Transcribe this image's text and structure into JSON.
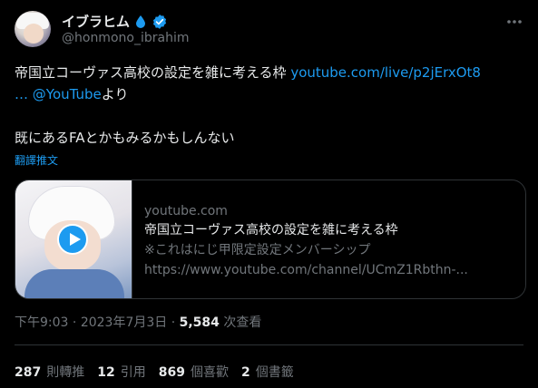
{
  "user": {
    "display_name": "イブラヒム",
    "handle": "@honmono_ibrahim"
  },
  "tweet": {
    "text_main": "帝国立コーヴァス高校の設定を雑に考える枠 ",
    "link_url": "youtube.com/live/p2jErxOt8",
    "ellipsis": "…",
    "mention": "@YouTube",
    "suffix": "より",
    "paragraph2": "既にあるFAとかもみるかもしんない",
    "translate_label": "翻譯推文"
  },
  "card": {
    "domain": "youtube.com",
    "title": "帝国立コーヴァス高校の設定を雑に考える枠",
    "description": "※これはにじ甲限定設定メンバーシップ",
    "url": "https://www.youtube.com/channel/UCmZ1Rbthn-..."
  },
  "meta": {
    "time": "下午9:03",
    "sep1": "·",
    "date": "2023年7月3日",
    "sep2": "·",
    "views_count": "5,584",
    "views_label": "次查看"
  },
  "stats": [
    {
      "num": "287",
      "label": "則轉推"
    },
    {
      "num": "12",
      "label": "引用"
    },
    {
      "num": "869",
      "label": "個喜歡"
    },
    {
      "num": "2",
      "label": "個書籤"
    }
  ],
  "colors": {
    "background": "#000000",
    "text": "#e7e9ea",
    "muted": "#71767b",
    "link": "#1d9bf0",
    "border": "#2f3336"
  },
  "icons": [
    "water-drop-icon",
    "verified-badge-icon",
    "more-options-icon",
    "play-icon"
  ]
}
